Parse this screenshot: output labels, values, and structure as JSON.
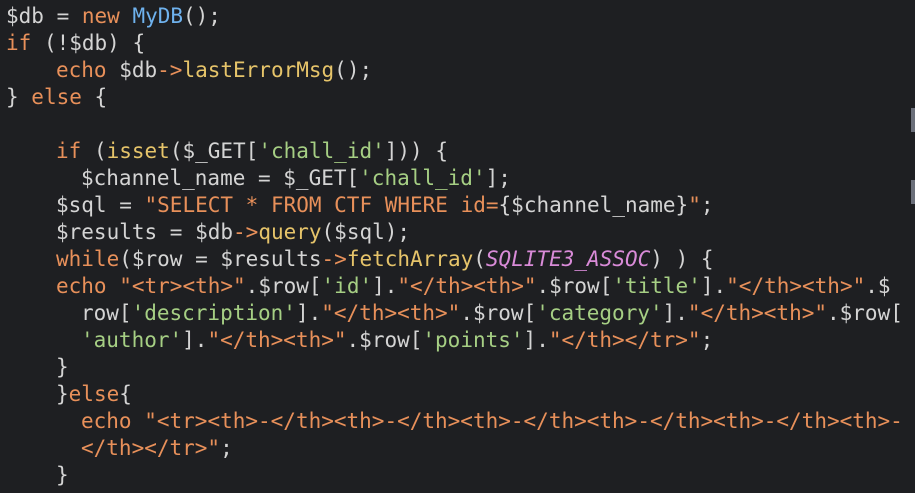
{
  "editor": {
    "theme_colors": {
      "background": "#1e1f22",
      "keyword": "#e8905a",
      "function": "#e6c46a",
      "class": "#6fb2ee",
      "string": "#a6cf84",
      "constant": "#d98bd8",
      "text": "#d4d4d4"
    },
    "lines": [
      {
        "indent": 0,
        "tokens": [
          {
            "t": "$db = ",
            "c": "var"
          },
          {
            "t": "new ",
            "c": "kw"
          },
          {
            "t": "MyDB",
            "c": "cls"
          },
          {
            "t": "();",
            "c": "op"
          }
        ]
      },
      {
        "indent": 0,
        "tokens": [
          {
            "t": "if",
            "c": "kw"
          },
          {
            "t": " (!$db) {",
            "c": "op"
          }
        ]
      },
      {
        "indent": 50,
        "tokens": [
          {
            "t": "echo",
            "c": "kw"
          },
          {
            "t": " $db",
            "c": "var"
          },
          {
            "t": "->",
            "c": "arrow"
          },
          {
            "t": "lastErrorMsg",
            "c": "fn"
          },
          {
            "t": "();",
            "c": "op"
          }
        ]
      },
      {
        "indent": 0,
        "tokens": [
          {
            "t": "} ",
            "c": "op"
          },
          {
            "t": "else",
            "c": "kw"
          },
          {
            "t": " {",
            "c": "op"
          }
        ]
      },
      {
        "indent": 0,
        "tokens": []
      },
      {
        "indent": 50,
        "tokens": [
          {
            "t": "if",
            "c": "kw"
          },
          {
            "t": " (",
            "c": "op"
          },
          {
            "t": "isset",
            "c": "fn"
          },
          {
            "t": "($_GET[",
            "c": "var"
          },
          {
            "t": "'chall_id'",
            "c": "str"
          },
          {
            "t": "])) {",
            "c": "op"
          }
        ]
      },
      {
        "indent": 75,
        "tokens": [
          {
            "t": "$channel_name = $_GET[",
            "c": "var"
          },
          {
            "t": "'chall_id'",
            "c": "str"
          },
          {
            "t": "];",
            "c": "op"
          }
        ]
      },
      {
        "indent": 50,
        "tokens": [
          {
            "t": "$sql = ",
            "c": "var"
          },
          {
            "t": "\"SELECT * FROM CTF WHERE id=",
            "c": "strq"
          },
          {
            "t": "{$channel_name}",
            "c": "var"
          },
          {
            "t": "\"",
            "c": "strq"
          },
          {
            "t": ";",
            "c": "op"
          }
        ]
      },
      {
        "indent": 50,
        "tokens": [
          {
            "t": "$results = $db",
            "c": "var"
          },
          {
            "t": "->",
            "c": "arrow"
          },
          {
            "t": "query",
            "c": "fn"
          },
          {
            "t": "($sql);",
            "c": "var"
          }
        ]
      },
      {
        "indent": 50,
        "tokens": [
          {
            "t": "while",
            "c": "kw"
          },
          {
            "t": "($row = $results",
            "c": "var"
          },
          {
            "t": "->",
            "c": "arrow"
          },
          {
            "t": "fetchArray",
            "c": "fn"
          },
          {
            "t": "(",
            "c": "op"
          },
          {
            "t": "SQLITE3_ASSOC",
            "c": "const"
          },
          {
            "t": ") ) {",
            "c": "op"
          }
        ]
      },
      {
        "indent": 50,
        "tokens": [
          {
            "t": "echo",
            "c": "kw"
          },
          {
            "t": " ",
            "c": "op"
          },
          {
            "t": "\"<tr><th>\"",
            "c": "strq"
          },
          {
            "t": ".$row[",
            "c": "var"
          },
          {
            "t": "'id'",
            "c": "str"
          },
          {
            "t": "].",
            "c": "op"
          },
          {
            "t": "\"</th><th>\"",
            "c": "strq"
          },
          {
            "t": ".$row[",
            "c": "var"
          },
          {
            "t": "'title'",
            "c": "str"
          },
          {
            "t": "].",
            "c": "op"
          },
          {
            "t": "\"</th><th>\"",
            "c": "strq"
          },
          {
            "t": ".$",
            "c": "var"
          }
        ]
      },
      {
        "indent": 75,
        "tokens": [
          {
            "t": "row[",
            "c": "var"
          },
          {
            "t": "'description'",
            "c": "str"
          },
          {
            "t": "].",
            "c": "op"
          },
          {
            "t": "\"</th><th>\"",
            "c": "strq"
          },
          {
            "t": ".$row[",
            "c": "var"
          },
          {
            "t": "'category'",
            "c": "str"
          },
          {
            "t": "].",
            "c": "op"
          },
          {
            "t": "\"</th><th>\"",
            "c": "strq"
          },
          {
            "t": ".$row[",
            "c": "var"
          }
        ]
      },
      {
        "indent": 75,
        "tokens": [
          {
            "t": "'author'",
            "c": "str"
          },
          {
            "t": "].",
            "c": "op"
          },
          {
            "t": "\"</th><th>\"",
            "c": "strq"
          },
          {
            "t": ".$row[",
            "c": "var"
          },
          {
            "t": "'points'",
            "c": "str"
          },
          {
            "t": "].",
            "c": "op"
          },
          {
            "t": "\"</th></tr>\"",
            "c": "strq"
          },
          {
            "t": ";",
            "c": "op"
          }
        ]
      },
      {
        "indent": 50,
        "tokens": [
          {
            "t": "}",
            "c": "op"
          }
        ]
      },
      {
        "indent": 50,
        "tokens": [
          {
            "t": "}",
            "c": "op"
          },
          {
            "t": "else",
            "c": "kw"
          },
          {
            "t": "{",
            "c": "op"
          }
        ]
      },
      {
        "indent": 75,
        "tokens": [
          {
            "t": "echo",
            "c": "kw"
          },
          {
            "t": " ",
            "c": "op"
          },
          {
            "t": "\"<tr><th>-</th><th>-</th><th>-</th><th>-</th><th>-</th><th>-",
            "c": "strq"
          }
        ]
      },
      {
        "indent": 75,
        "tokens": [
          {
            "t": "</th></tr>\"",
            "c": "strq"
          },
          {
            "t": ";",
            "c": "op"
          }
        ]
      },
      {
        "indent": 50,
        "tokens": [
          {
            "t": "}",
            "c": "op"
          }
        ]
      }
    ]
  }
}
